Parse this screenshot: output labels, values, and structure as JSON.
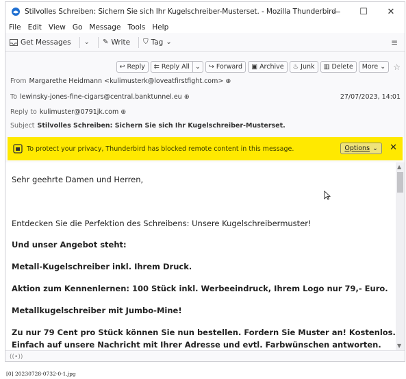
{
  "window": {
    "title": "Stilvolles Schreiben: Sichern Sie sich Ihr Kugelschreiber-Musterset. - Mozilla Thunderbird",
    "controls": [
      "—",
      "☐",
      "✕"
    ]
  },
  "menu": [
    "File",
    "Edit",
    "View",
    "Go",
    "Message",
    "Tools",
    "Help"
  ],
  "toolbar": {
    "get_messages": "Get Messages",
    "write": "Write",
    "tag": "Tag",
    "menu_icon": "hamburger-icon"
  },
  "actions": {
    "reply": "Reply",
    "reply_all": "Reply All",
    "forward": "Forward",
    "archive": "Archive",
    "junk": "Junk",
    "delete": "Delete",
    "more": "More"
  },
  "header": {
    "from_label": "From",
    "from_value": "Margarethe Heidmann <kulimusterk@loveatfirstfight.com>",
    "to_label": "To",
    "to_value": "lewinsky-jones-fine-cigars@central.banktunnel.eu",
    "date": "27/07/2023, 14:01",
    "reply_to_label": "Reply to",
    "reply_to_value": "kulimuster@0791jk.com",
    "subject_label": "Subject",
    "subject_value": "Stilvolles Schreiben: Sichern Sie sich Ihr Kugelschreiber-Musterset."
  },
  "notification": {
    "text": "To protect your privacy, Thunderbird has blocked remote content in this message.",
    "options_label": "Options",
    "close": "✕"
  },
  "body": {
    "greeting": "Sehr geehrte Damen und Herren,",
    "line1": "Entdecken Sie die Perfektion des Schreibens: Unsere Kugelschreibermuster!",
    "line2": "Und unser Angebot steht:",
    "line3": "Metall-Kugelschreiber inkl. Ihrem Druck.",
    "line4": "Aktion zum Kennenlernen: 100 Stück inkl. Werbeeindruck, Ihrem Logo nur 79,- Euro.",
    "line5": "Metallkugelschreiber mit Jumbo-Mine!",
    "line6": "Zu nur 79 Cent pro Stück können Sie nun bestellen. Fordern Sie Muster an! Kostenlos.",
    "line7": "Einfach auf unsere Nachricht mit Ihrer Adresse und evtl. Farbwünschen antworten."
  },
  "status": {
    "icon": "wifi-icon"
  },
  "caption": "[0] 20230728-0732-0-1.jpg",
  "colors": {
    "notification_bg": "#ffe900"
  }
}
